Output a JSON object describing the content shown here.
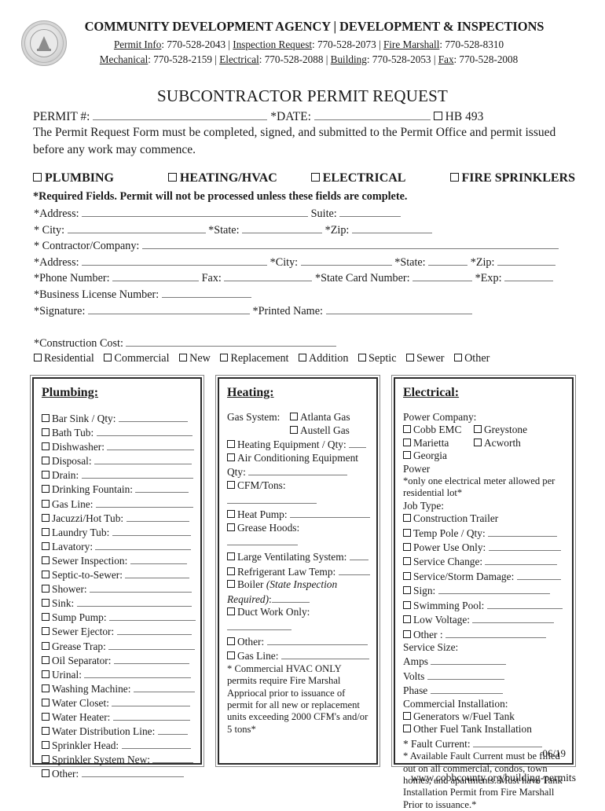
{
  "header": {
    "seal_icon": "county-seal-icon",
    "agency_title": "COMMUNITY DEVELOPMENT AGENCY | DEVELOPMENT & INSPECTIONS",
    "phone_line_1": [
      {
        "label": "Permit Info",
        "number": ": 770-528-2043"
      },
      {
        "label": "Inspection Request",
        "number": ": 770-528-2073"
      },
      {
        "label": "Fire Marshall",
        "number": ": 770-528-8310"
      }
    ],
    "phone_line_2": [
      {
        "label": "Mechanical",
        "number": ": 770-528-2159"
      },
      {
        "label": "Electrical",
        "number": ": 770-528-2088"
      },
      {
        "label": "Building",
        "number": ": 770-528-2053"
      },
      {
        "label": "Fax",
        "number": ": 770-528-2008"
      }
    ],
    "separator": " | "
  },
  "title": "SUBCONTRACTOR PERMIT REQUEST",
  "permit_row": {
    "permit_label": "PERMIT #: ",
    "date_label": "*DATE: ",
    "hb_label": "HB 493"
  },
  "intro": "The Permit Request Form must be completed, signed, and submitted to the Permit Office and permit issued before any work may commence.",
  "trades": [
    "PLUMBING",
    "HEATING/HVAC",
    "ELECTRICAL",
    "FIRE SPRINKLERS"
  ],
  "required_note": "*Required Fields. Permit will not be processed unless these fields are complete.",
  "fields": {
    "address_label": "*Address: ",
    "suite_label": "Suite: ",
    "city_label": "* City: ",
    "state_label": "*State: ",
    "zip_label": "*Zip: ",
    "contractor_label": "* Contractor/Company: ",
    "c_address_label": "*Address: ",
    "c_city_label": "*City: ",
    "c_state_label": "*State: ",
    "c_zip_label": "*Zip: ",
    "phone_label": "*Phone Number: ",
    "fax_label": "Fax: ",
    "state_card_label": "*State Card Number: ",
    "exp_label": "*Exp: ",
    "business_license_label": "*Business License Number: ",
    "signature_label": "*Signature: ",
    "printed_name_label": "*Printed Name: ",
    "construction_cost_label": "*Construction Cost: "
  },
  "project_types": [
    "Residential",
    "Commercial",
    "New",
    "Replacement",
    "Addition",
    "Septic",
    "Sewer",
    "Other"
  ],
  "plumbing": {
    "title": "Plumbing:",
    "items": [
      {
        "label": "Bar Sink / Qty:",
        "line": 88
      },
      {
        "label": "Bath Tub:",
        "line": 122
      },
      {
        "label": "Dishwasher:",
        "line": 111
      },
      {
        "label": "Disposal:",
        "line": 124
      },
      {
        "label": "Drain:",
        "line": 142
      },
      {
        "label": "Drinking Fountain:",
        "line": 68
      },
      {
        "label": "Gas Line:",
        "line": 124
      },
      {
        "label": "Jacuzzi/Hot Tub:",
        "line": 80
      },
      {
        "label": "Laundry Tub:",
        "line": 100
      },
      {
        "label": "Lavatory:",
        "line": 122
      },
      {
        "label": "Sewer Inspection:",
        "line": 72
      },
      {
        "label": "Septic-to-Sewer:",
        "line": 82
      },
      {
        "label": "Shower:",
        "line": 130
      },
      {
        "label": "Sink:",
        "line": 146
      },
      {
        "label": "Sump Pump:",
        "line": 110
      },
      {
        "label": "Sewer Ejector:",
        "line": 95
      },
      {
        "label": "Grease Trap:",
        "line": 110
      },
      {
        "label": "Oil Separator:",
        "line": 96
      },
      {
        "label": "Urinal:",
        "line": 136
      },
      {
        "label": "Washing Machine:",
        "line": 78
      },
      {
        "label": "Water Closet:",
        "line": 100
      },
      {
        "label": "Water Heater:",
        "line": 98
      },
      {
        "label": "Water Distribution Line:",
        "line": 38
      },
      {
        "label": "Sprinkler Head:",
        "line": 88
      },
      {
        "label": "Sprinkler System New:",
        "line": 52
      },
      {
        "label": "Other:",
        "line": 130
      }
    ]
  },
  "heating": {
    "title": "Heating:",
    "gas_system_label": "Gas System:",
    "gas_options": [
      "Atlanta Gas",
      "Austell Gas"
    ],
    "items": [
      {
        "label": "Heating Equipment / Qty:",
        "line": 22
      },
      {
        "label": "Air Conditioning Equipment",
        "line": 0
      }
    ],
    "qty_label": "Qty:",
    "qty_line": 126,
    "items2": [
      {
        "label": "CFM/Tons:",
        "line": 114,
        "tight": true
      },
      {
        "label": "Heat Pump:",
        "line": 102,
        "tight": true
      },
      {
        "label": "Grease Hoods:",
        "line": 90,
        "tight": false
      },
      {
        "label": "Large Ventilating System:",
        "line": 24,
        "tight": false
      },
      {
        "label": "Refrigerant Law Temp:",
        "line": 40,
        "tight": false
      }
    ],
    "boiler_label": "Boiler ",
    "boiler_italic": "(State Inspection Required)",
    "boiler_line": 48,
    "items3": [
      {
        "label": "Duct Work Only:",
        "line": 82
      },
      {
        "label": "Other:",
        "line": 128
      },
      {
        "label": "Gas Line:",
        "line": 112
      }
    ],
    "note": "* Commercial HVAC ONLY permits require Fire Marshal Appriocal prior to issuance of permit for all new or replacement units exceeding 2000 CFM's and/or 5 tons*"
  },
  "electrical": {
    "title": "Electrical:",
    "power_company_label": "Power Company:",
    "power_companies": [
      [
        "Cobb EMC",
        "Greystone"
      ],
      [
        "Marietta",
        "Acworth"
      ],
      [
        "Georgia Power",
        ""
      ]
    ],
    "meter_note": "*only one electrical meter allowed per residential lot*",
    "job_type_label": "Job Type:",
    "job_types": [
      {
        "label": "Construction Trailer",
        "line": 0
      },
      {
        "label": "Temp Pole / Qty:",
        "line": 88
      },
      {
        "label": "Power Use Only:",
        "line": 92
      },
      {
        "label": "Service Change:",
        "line": 92
      },
      {
        "label": "Service/Storm Damage:",
        "line": 56
      },
      {
        "label": "Sign:",
        "line": 142
      },
      {
        "label": "Swimming Pool:",
        "line": 96
      },
      {
        "label": "Low Voltage:",
        "line": 104
      },
      {
        "label": "Other :",
        "line": 128
      }
    ],
    "service_size_label": "Service Size:",
    "service_sizes": [
      {
        "label": "Amps",
        "line": 96
      },
      {
        "label": "Volts",
        "line": 98
      },
      {
        "label": "Phase",
        "line": 92
      }
    ],
    "commercial_label": "Commercial Installation:",
    "commercial_items": [
      "Generators w/Fuel Tank",
      "Other Fuel Tank Installation"
    ],
    "fault_current_label": "* Fault Current: ",
    "fault_current_line": 88,
    "fault_note": "* Available Fault Current must be filled out on all commercial, condos, town homes, and apartments. Must have Tank Installation Permit from Fire Marshall Prior to issuance.*",
    "revision_stamp": "06/19"
  },
  "footer_url": "www.cobbcounty.org/building-permits"
}
